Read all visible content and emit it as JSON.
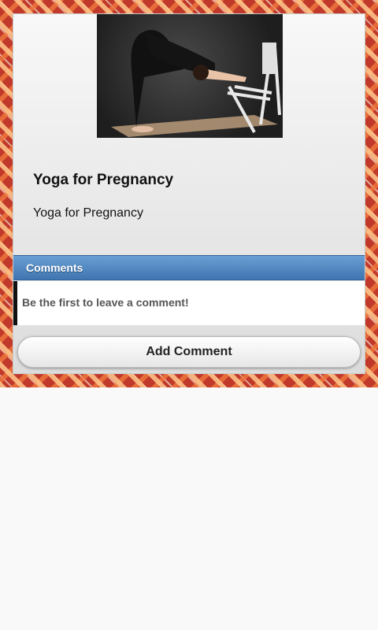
{
  "post": {
    "title": "Yoga for Pregnancy",
    "description": "Yoga for Pregnancy"
  },
  "comments": {
    "header": "Comments",
    "empty_message": "Be the first to leave a comment!",
    "add_button_label": "Add Comment"
  },
  "colors": {
    "comments_header": "#4f87c2",
    "background_pattern": "#c0392b",
    "card": "#eeeeee"
  }
}
